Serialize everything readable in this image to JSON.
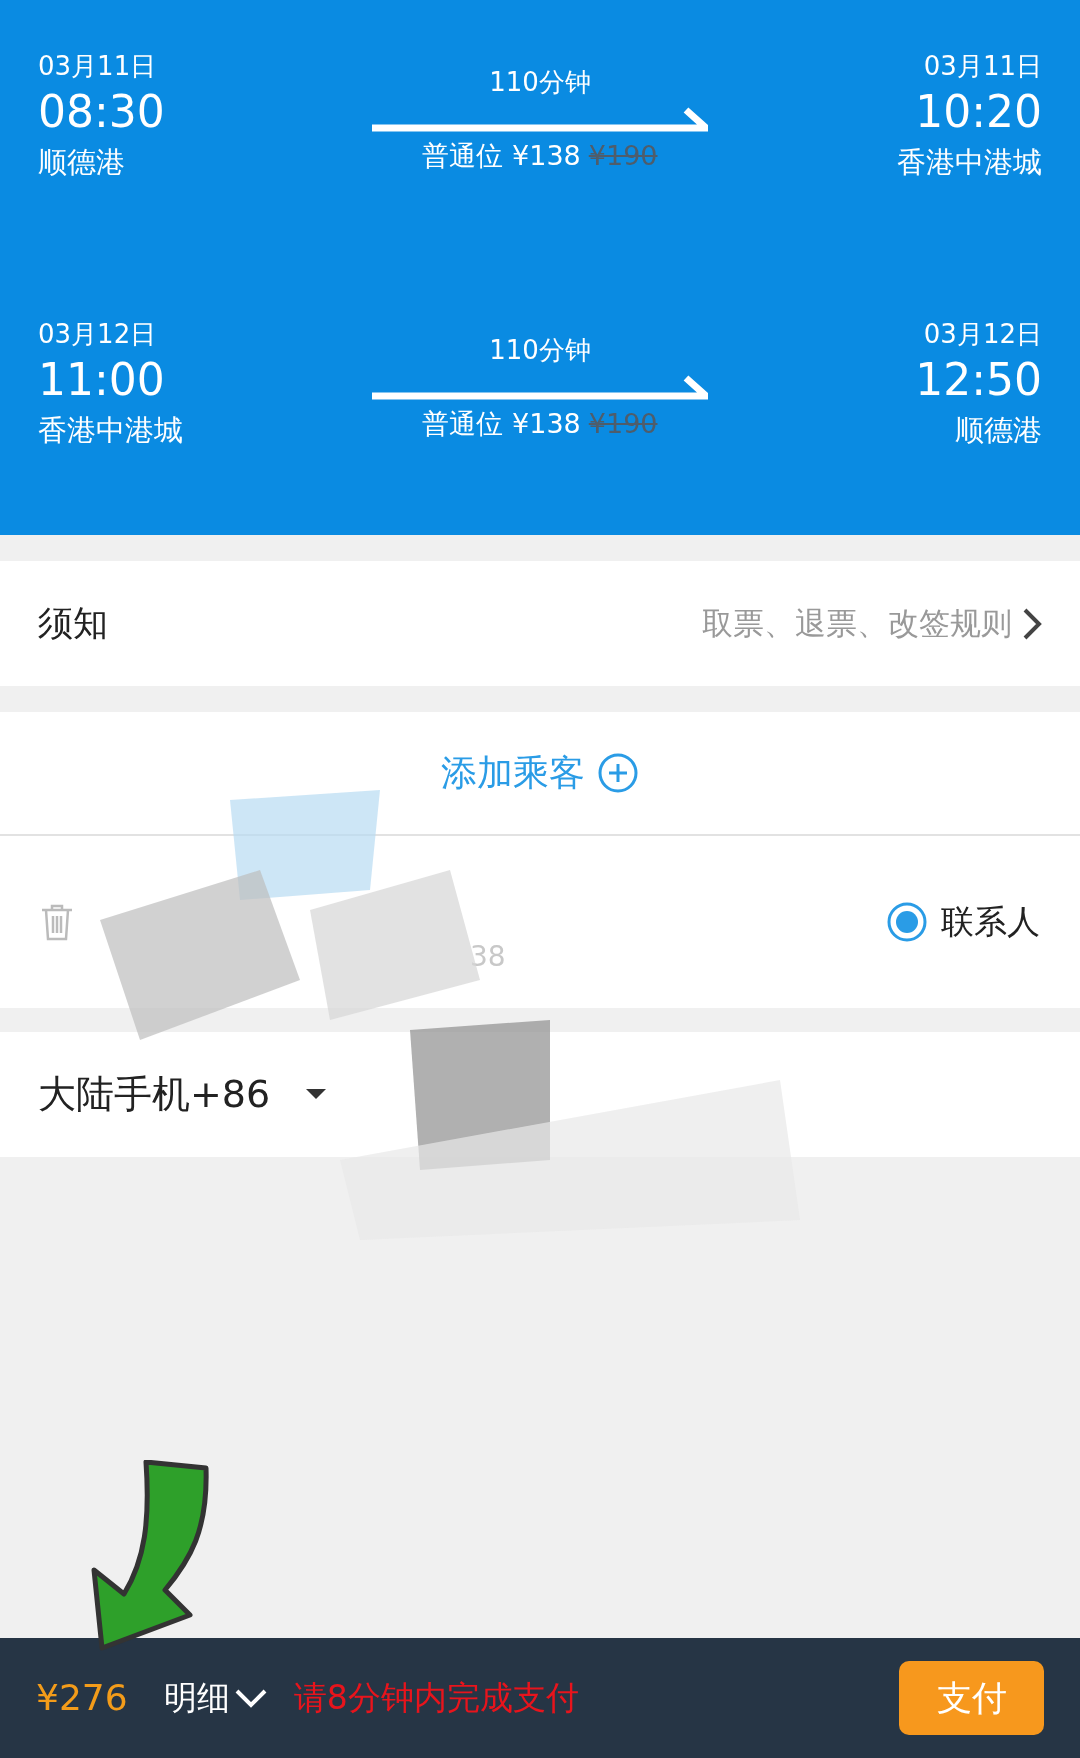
{
  "trips": [
    {
      "depart_date": "03月11日",
      "depart_time": "08:30",
      "depart_port": "顺德港",
      "duration": "110分钟",
      "seat_price": "普通位 ¥138",
      "original_price": "¥190",
      "arrive_date": "03月11日",
      "arrive_time": "10:20",
      "arrive_port": "香港中港城"
    },
    {
      "depart_date": "03月12日",
      "depart_time": "11:00",
      "depart_port": "香港中港城",
      "duration": "110分钟",
      "seat_price": "普通位 ¥138",
      "original_price": "¥190",
      "arrive_date": "03月12日",
      "arrive_time": "12:50",
      "arrive_port": "顺德港"
    }
  ],
  "notice": {
    "title": "须知",
    "link": "取票、退票、改签规则"
  },
  "add_passenger": "添加乘客",
  "passenger": {
    "id_fragment": "38",
    "contact_label": "联系人",
    "contact_selected": true
  },
  "phone": {
    "region": "大陆手机+86"
  },
  "bottom_bar": {
    "total": "¥276",
    "details": "明细",
    "timer": "请8分钟内完成支付",
    "pay": "支付"
  }
}
